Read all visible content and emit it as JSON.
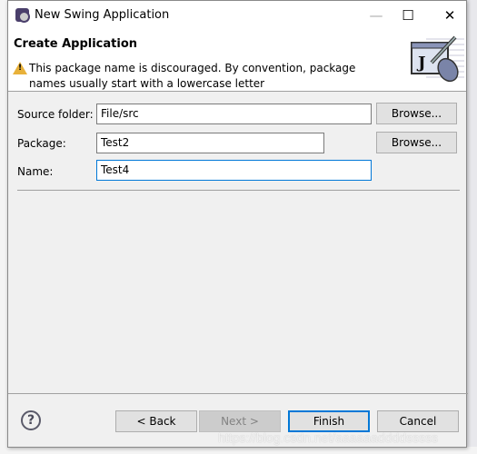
{
  "window": {
    "title": "New Swing Application",
    "minimize": "—",
    "maximize": "☐",
    "close": "✕"
  },
  "header": {
    "title": "Create Application",
    "warning": "This package name is discouraged. By convention, package names usually start with a lowercase letter",
    "banner_letter": "J"
  },
  "form": {
    "source_folder": {
      "label": "Source folder:",
      "value": "File/src",
      "browse": "Browse..."
    },
    "package": {
      "label": "Package:",
      "value": "Test2",
      "browse": "Browse..."
    },
    "name": {
      "label": "Name:",
      "value": "Test4"
    }
  },
  "footer": {
    "help": "?",
    "back": "< Back",
    "next": "Next >",
    "finish": "Finish",
    "cancel": "Cancel"
  },
  "watermark": "https://blog.csdn.net/aaaaaaddddsssss",
  "colors": {
    "focus": "#0078d7",
    "warning": "#e8b13a"
  }
}
